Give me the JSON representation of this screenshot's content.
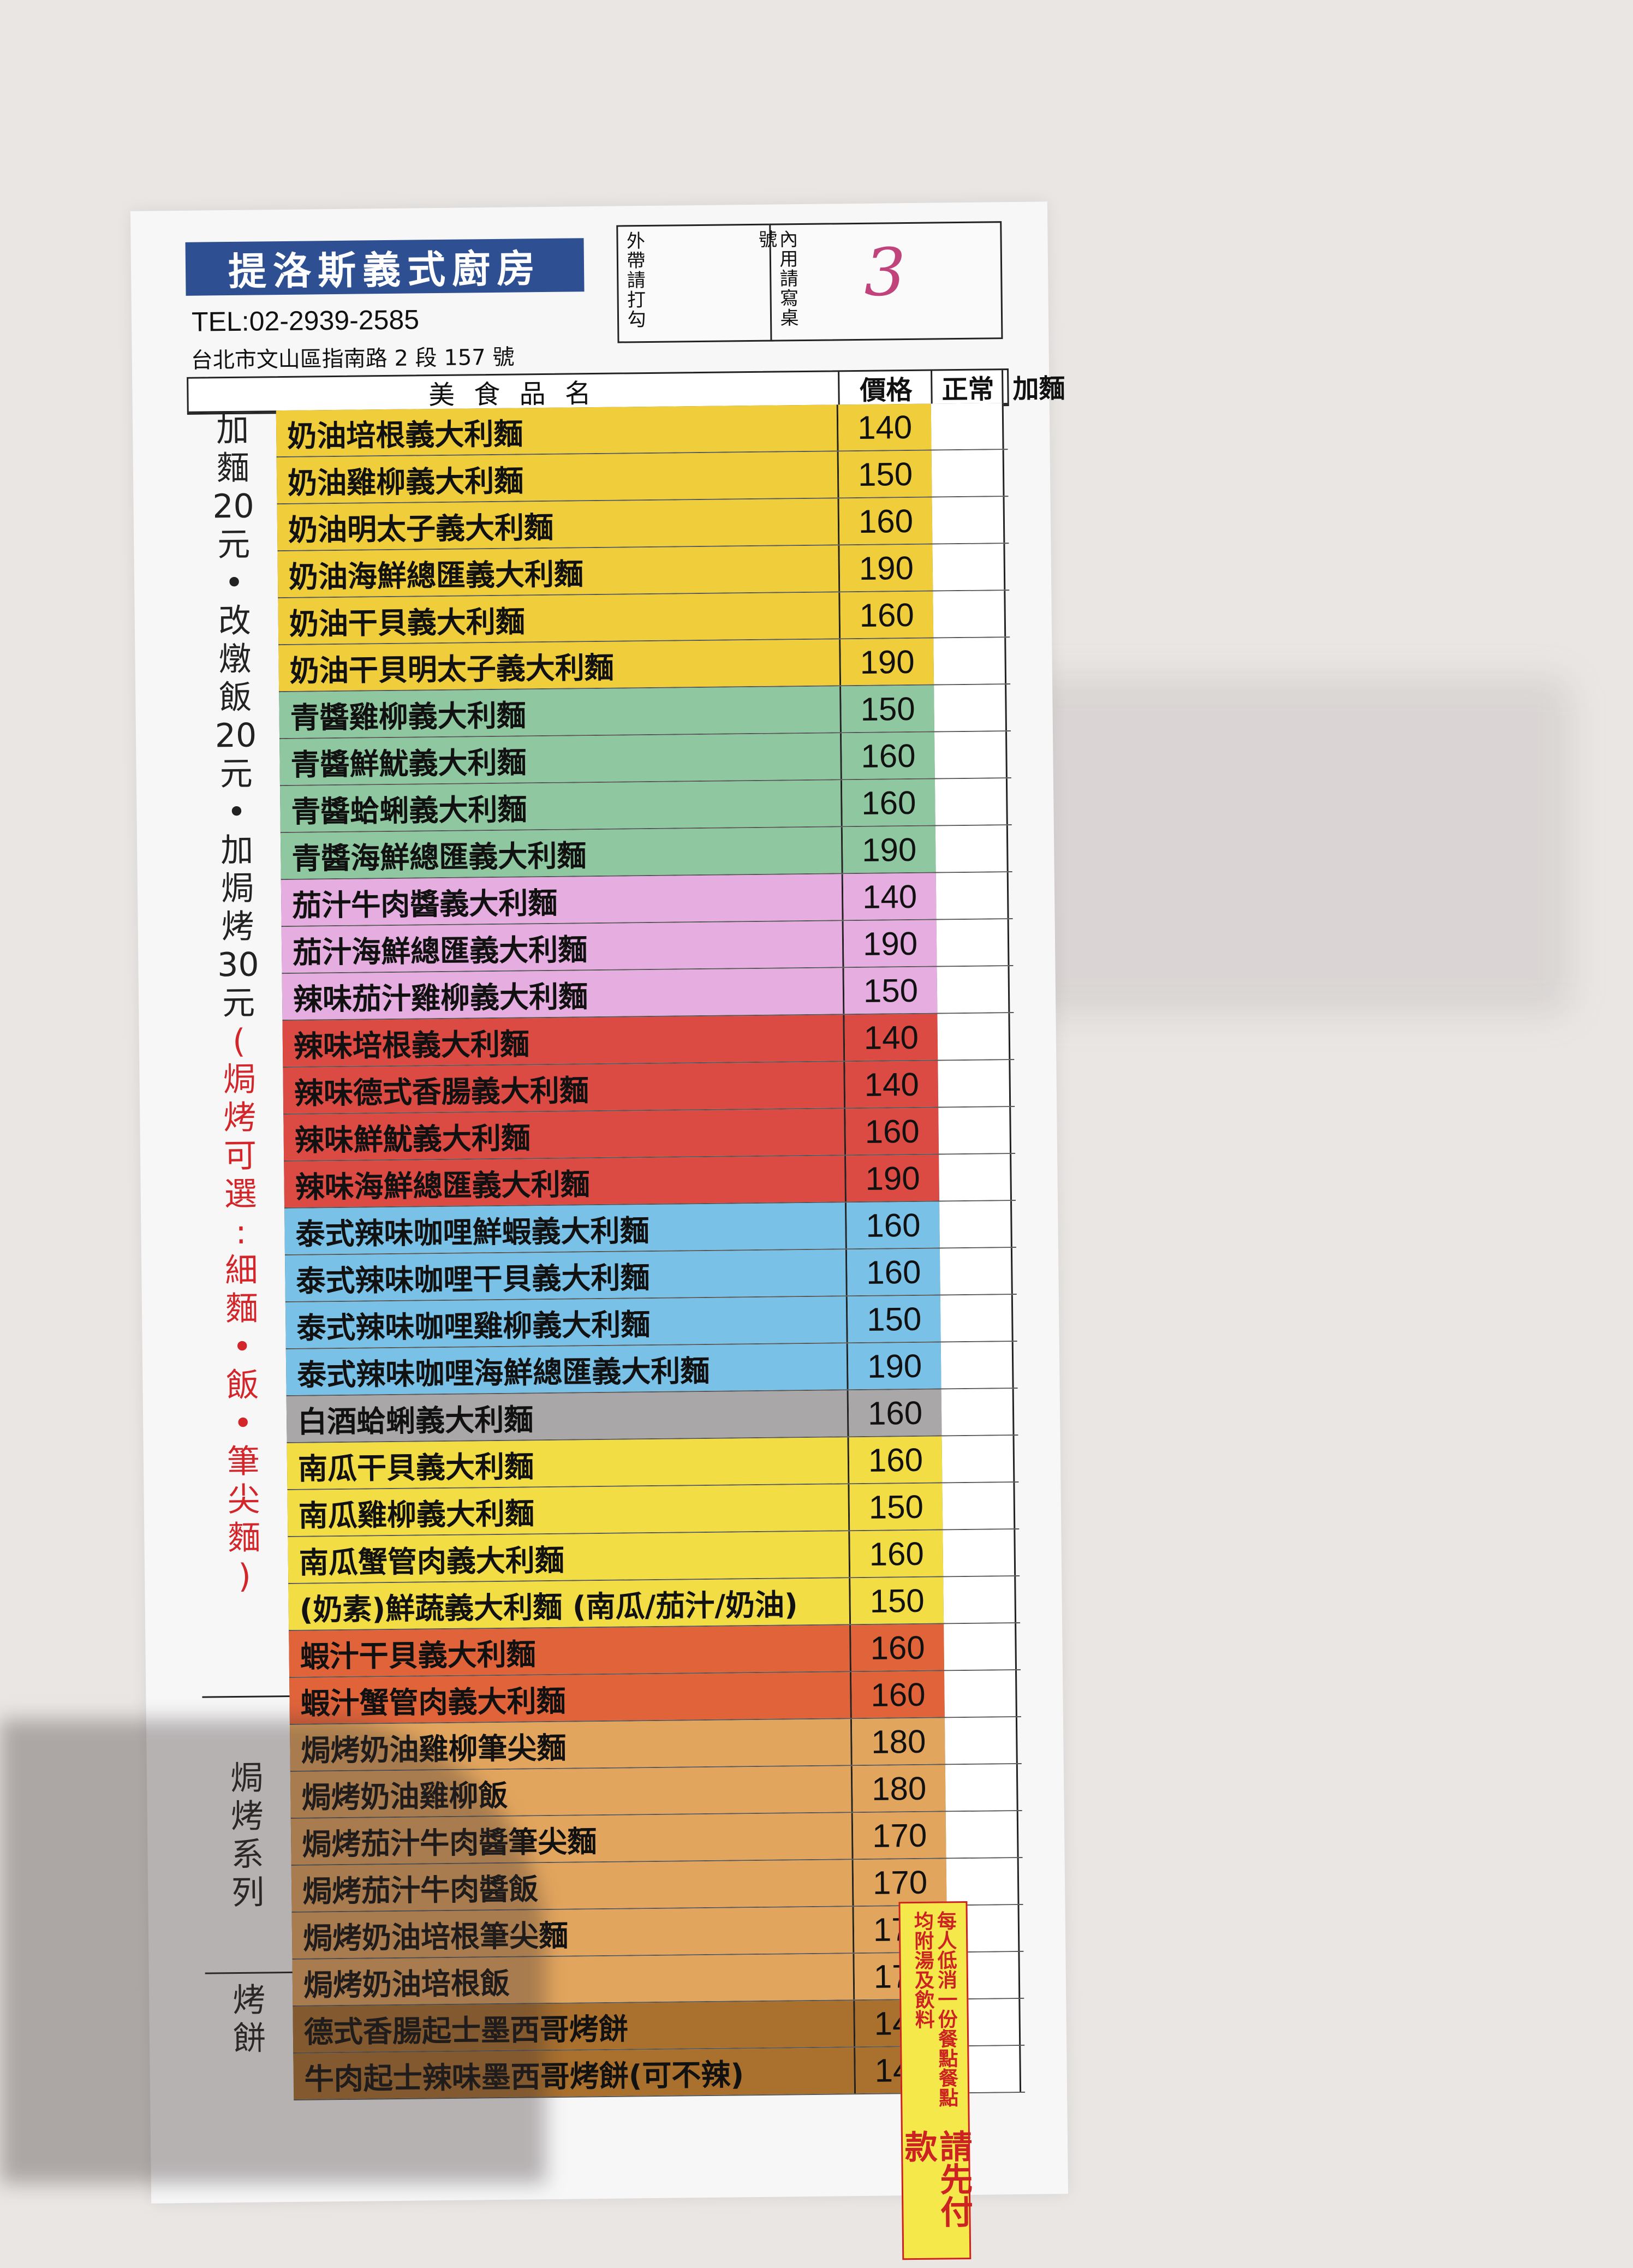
{
  "restaurant": {
    "name": "提洛斯義式廚房",
    "tel": "TEL:02-2939-2585",
    "address": "台北市文山區指南路 2 段 157 號"
  },
  "order_boxes": {
    "takeout_label": "外帶請打勾",
    "dinein_label": "內用請寫桌號",
    "table_number": "3"
  },
  "table_header": {
    "item": "美 食 品 名",
    "price": "價格",
    "normal": "正常",
    "extra_noodle": "加麵"
  },
  "sidebar_notes": {
    "top_black": [
      "加",
      "麵",
      "20",
      "元",
      "•",
      "改",
      "燉",
      "飯",
      "20",
      "元",
      "•",
      "加",
      "焗",
      "烤",
      "30",
      "元"
    ],
    "top_red": [
      "(",
      "焗",
      "烤",
      "可",
      "選",
      ":",
      "細",
      "麵",
      "•",
      "飯",
      "•",
      "筆",
      "尖",
      "麵",
      ")"
    ],
    "baked_series": [
      "焗",
      "烤",
      "系",
      "列"
    ],
    "pancake": [
      "烤",
      "餅"
    ]
  },
  "colors": {
    "yellow": "#f0cd3a",
    "green": "#8fc8a0",
    "pink": "#e6aee0",
    "red": "#db4a43",
    "blue": "#79c1e6",
    "gray": "#a9a7a8",
    "yellow2": "#f2dd45",
    "orange": "#e0633a",
    "tan": "#e2a55e",
    "brown": "#a9702e",
    "notice_bg": "#f5e84a",
    "brand_bg": "#2e4f92"
  },
  "menu_items": [
    {
      "name": "奶油培根義大利麵",
      "price": "140",
      "color": "#f0cd3a"
    },
    {
      "name": "奶油雞柳義大利麵",
      "price": "150",
      "color": "#f0cd3a"
    },
    {
      "name": "奶油明太子義大利麵",
      "price": "160",
      "color": "#f0cd3a"
    },
    {
      "name": "奶油海鮮總匯義大利麵",
      "price": "190",
      "color": "#f0cd3a"
    },
    {
      "name": "奶油干貝義大利麵",
      "price": "160",
      "color": "#f0cd3a"
    },
    {
      "name": "奶油干貝明太子義大利麵",
      "price": "190",
      "color": "#f0cd3a"
    },
    {
      "name": "青醬雞柳義大利麵",
      "price": "150",
      "color": "#8fc8a0"
    },
    {
      "name": "青醬鮮魷義大利麵",
      "price": "160",
      "color": "#8fc8a0"
    },
    {
      "name": "青醬蛤蜊義大利麵",
      "price": "160",
      "color": "#8fc8a0"
    },
    {
      "name": "青醬海鮮總匯義大利麵",
      "price": "190",
      "color": "#8fc8a0"
    },
    {
      "name": "茄汁牛肉醬義大利麵",
      "price": "140",
      "color": "#e6aee0"
    },
    {
      "name": "茄汁海鮮總匯義大利麵",
      "price": "190",
      "color": "#e6aee0"
    },
    {
      "name": "辣味茄汁雞柳義大利麵",
      "price": "150",
      "color": "#e6aee0"
    },
    {
      "name": "辣味培根義大利麵",
      "price": "140",
      "color": "#db4a43"
    },
    {
      "name": "辣味德式香腸義大利麵",
      "price": "140",
      "color": "#db4a43"
    },
    {
      "name": "辣味鮮魷義大利麵",
      "price": "160",
      "color": "#db4a43"
    },
    {
      "name": "辣味海鮮總匯義大利麵",
      "price": "190",
      "color": "#db4a43"
    },
    {
      "name": "泰式辣味咖哩鮮蝦義大利麵",
      "price": "160",
      "color": "#79c1e6"
    },
    {
      "name": "泰式辣味咖哩干貝義大利麵",
      "price": "160",
      "color": "#79c1e6"
    },
    {
      "name": "泰式辣味咖哩雞柳義大利麵",
      "price": "150",
      "color": "#79c1e6"
    },
    {
      "name": "泰式辣味咖哩海鮮總匯義大利麵",
      "price": "190",
      "color": "#79c1e6"
    },
    {
      "name": "白酒蛤蜊義大利麵",
      "price": "160",
      "color": "#a9a7a8"
    },
    {
      "name": "南瓜干貝義大利麵",
      "price": "160",
      "color": "#f2dd45"
    },
    {
      "name": "南瓜雞柳義大利麵",
      "price": "150",
      "color": "#f2dd45"
    },
    {
      "name": "南瓜蟹管肉義大利麵",
      "price": "160",
      "color": "#f2dd45"
    },
    {
      "name": "(奶素)鮮蔬義大利麵 (南瓜/茄汁/奶油)",
      "price": "150",
      "color": "#f2dd45"
    },
    {
      "name": "蝦汁干貝義大利麵",
      "price": "160",
      "color": "#e0633a"
    },
    {
      "name": "蝦汁蟹管肉義大利麵",
      "price": "160",
      "color": "#e0633a"
    },
    {
      "name": "焗烤奶油雞柳筆尖麵",
      "price": "180",
      "color": "#e2a55e"
    },
    {
      "name": "焗烤奶油雞柳飯",
      "price": "180",
      "color": "#e2a55e"
    },
    {
      "name": "焗烤茄汁牛肉醬筆尖麵",
      "price": "170",
      "color": "#e2a55e"
    },
    {
      "name": "焗烤茄汁牛肉醬飯",
      "price": "170",
      "color": "#e2a55e"
    },
    {
      "name": "焗烤奶油培根筆尖麵",
      "price": "170",
      "color": "#e2a55e"
    },
    {
      "name": "焗烤奶油培根飯",
      "price": "170",
      "color": "#e2a55e"
    },
    {
      "name": "德式香腸起士墨西哥烤餅",
      "price": "140",
      "color": "#a9702e"
    },
    {
      "name": "牛肉起士辣味墨西哥烤餅(可不辣)",
      "price": "140",
      "color": "#a9702e"
    }
  ],
  "notice": {
    "small_text": "每人低消一份餐點餐點均附湯及飲料",
    "big_text": "請先付款"
  }
}
